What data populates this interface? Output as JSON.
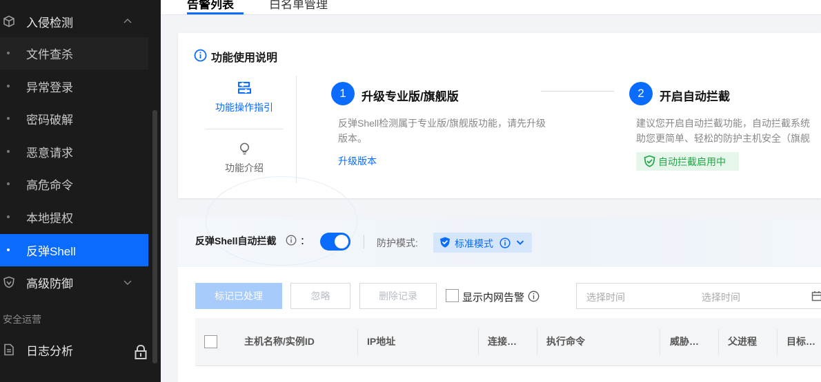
{
  "sidebar": {
    "group_intrusion": "入侵检测",
    "items": [
      "文件查杀",
      "异常登录",
      "密码破解",
      "恶意请求",
      "高危命令",
      "本地提权",
      "反弹Shell"
    ],
    "group_advanced": "高级防御",
    "section_security_ops": "安全运营",
    "log_analysis": "日志分析"
  },
  "tabs": {
    "alerts": "告警列表",
    "whitelist": "白名单管理"
  },
  "usage": {
    "title": "功能使用说明",
    "side_guide": "功能操作指引",
    "side_intro": "功能介绍",
    "step1": {
      "num": "1",
      "title": "升级专业版/旗舰版",
      "desc_line1": "反弹Shell检测属于专业版/旗舰版功能，请先升级",
      "desc_line2": "版本。",
      "link": "升级版本"
    },
    "step2": {
      "num": "2",
      "title": "开启自动拦截",
      "desc_line1": "建议您开启自动拦截功能，自动拦截系统",
      "desc_line2": "助您更简单、轻松的防护主机安全（旗舰",
      "badge": "自动拦截启用中"
    }
  },
  "controls": {
    "auto_block_label": "反弹Shell自动拦截",
    "colon": "：",
    "mode_label": "防护模式:",
    "mode_value": "标准模式",
    "toggle_on": true
  },
  "toolbar": {
    "mark_processed": "标记已处理",
    "ignore": "忽略",
    "delete_records": "删除记录",
    "show_intranet": "显示内网告警",
    "date_start_placeholder": "选择时间",
    "date_end_placeholder": "选择时间"
  },
  "table": {
    "columns": [
      "主机名称/实例ID",
      "IP地址",
      "连接…",
      "执行命令",
      "威胁…",
      "父进程",
      "目标…"
    ]
  },
  "colors": {
    "accent": "#0a6bff",
    "sidebar_bg": "#1b1b1b",
    "success": "#1fa745"
  }
}
